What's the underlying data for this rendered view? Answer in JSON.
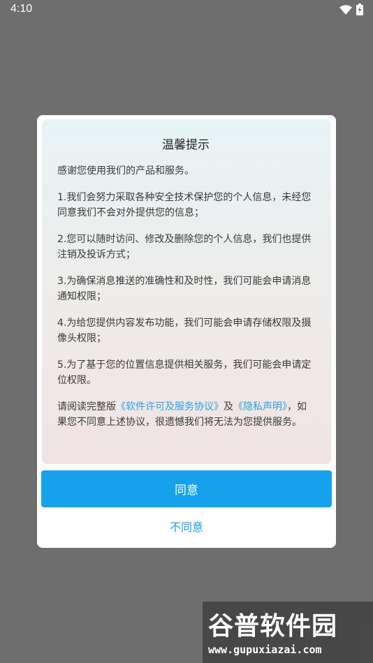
{
  "status_bar": {
    "time": "4:10",
    "icons": [
      "wifi-icon",
      "battery-charging-icon"
    ]
  },
  "dialog": {
    "title": "温馨提示",
    "intro": "感谢您使用我们的产品和服务。",
    "items": [
      "1.我们会努力采取各种安全技术保护您的个人信息，未经您同意我们不会对外提供您的信息；",
      "2.您可以随时访问、修改及删除您的个人信息，我们也提供注销及投诉方式；",
      "3.为确保消息推送的准确性和及时性，我们可能会申请消息通知权限；",
      "4.为给您提供内容发布功能，我们可能会申请存储权限及摄像头权限；",
      "5.为了基于您的位置信息提供相关服务，我们可能会申请定位权限。"
    ],
    "closing": {
      "prefix": "请阅读完整版",
      "link1": "《软件许可及服务协议》",
      "middle": "及",
      "link2": "《隐私声明》",
      "suffix": "，如果您不同意上述协议，很遗憾我们将无法为您提供服务。"
    },
    "agree_label": "同意",
    "disagree_label": "不同意"
  },
  "watermark": {
    "title": "谷普软件园",
    "url": "www.gupuxiazai.com"
  },
  "colors": {
    "accent": "#16a1ed",
    "link": "#29a3e6",
    "backdrop": "#6e6e6e"
  }
}
